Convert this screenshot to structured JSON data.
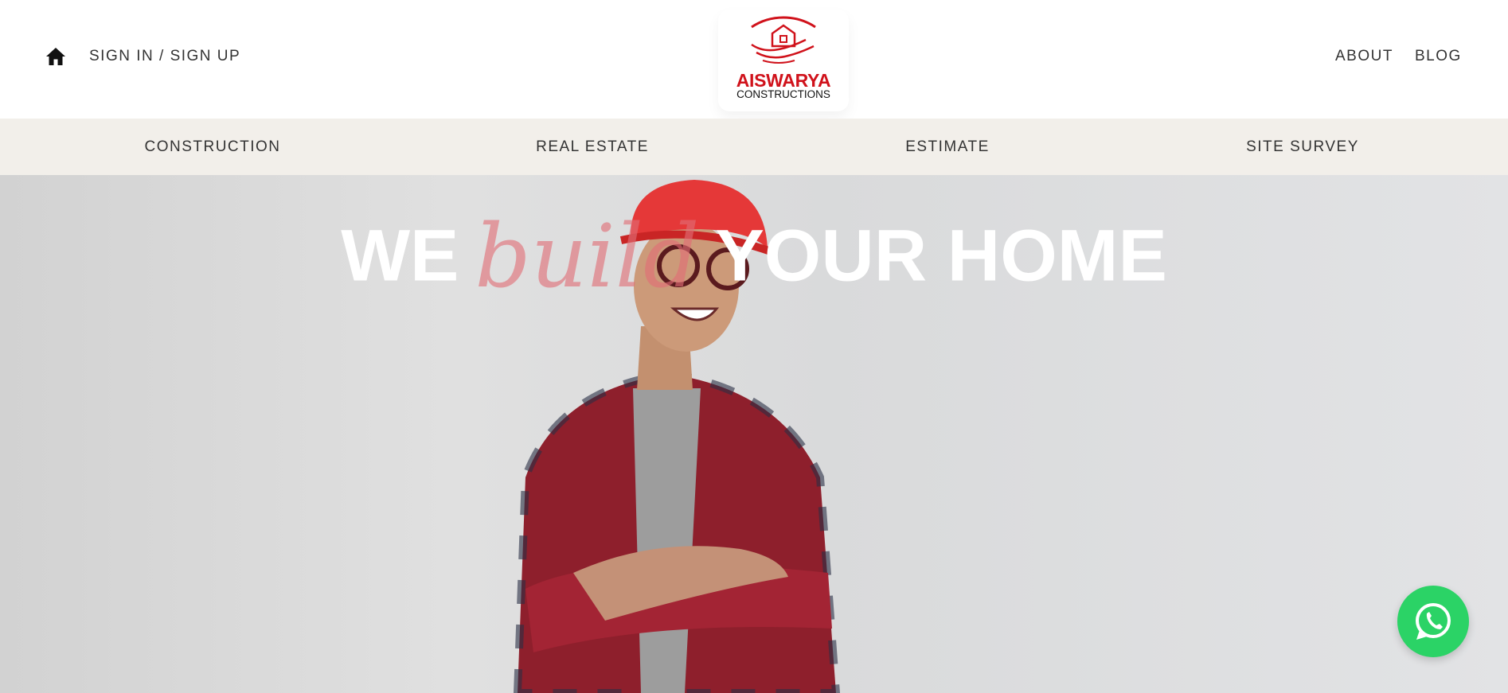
{
  "header": {
    "home_icon": "home-icon",
    "signin_label": "SIGN IN / SIGN UP",
    "about_label": "ABOUT",
    "blog_label": "BLOG",
    "logo": {
      "name": "AISWARYA",
      "subtitle": "CONSTRUCTIONS"
    }
  },
  "nav": {
    "items": [
      {
        "label": "CONSTRUCTION"
      },
      {
        "label": "REAL ESTATE"
      },
      {
        "label": "ESTIMATE"
      },
      {
        "label": "SITE SURVEY"
      }
    ]
  },
  "hero": {
    "word1": "WE",
    "script_word": "build",
    "word2": "YOUR HOME",
    "image": "smiling construction worker with red hard hat"
  },
  "fab": {
    "icon": "whatsapp-icon"
  },
  "colors": {
    "brand_red": "#d0121b",
    "nav_bg": "#f2efea",
    "whatsapp_green": "#2bd366"
  }
}
